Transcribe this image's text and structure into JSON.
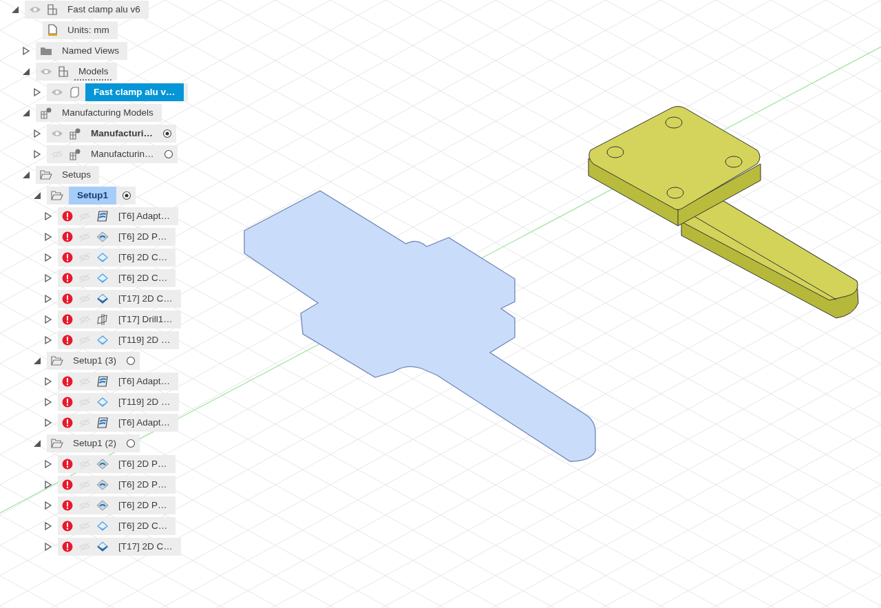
{
  "browser_tree": {
    "items": [
      {
        "label": "Fast clamp alu v6",
        "expanded": true,
        "visible": true,
        "kind": "component",
        "selected": false,
        "children": [
          {
            "label": "Units: mm",
            "kind": "document",
            "selected": false
          },
          {
            "label": "Named Views",
            "expanded": false,
            "kind": "folder",
            "selected": false
          },
          {
            "label": "Models",
            "expanded": true,
            "visible": true,
            "kind": "model-group",
            "selected": false,
            "children": [
              {
                "label": "Fast clamp alu v…",
                "expanded": false,
                "visible": true,
                "kind": "body",
                "selected": true
              }
            ]
          },
          {
            "label": "Manufacturing Models",
            "expanded": true,
            "kind": "mfg",
            "selected": false,
            "children": [
              {
                "label": "Manufacturi…",
                "expanded": false,
                "visible": true,
                "kind": "mfg",
                "active": true,
                "selected": false
              },
              {
                "label": "Manufacturin…",
                "expanded": false,
                "visible": false,
                "kind": "mfg",
                "active": false,
                "selected": false
              }
            ]
          },
          {
            "label": "Setups",
            "expanded": true,
            "kind": "setup",
            "selected": false,
            "children": [
              {
                "label": "Setup1",
                "expanded": true,
                "kind": "setup",
                "active": true,
                "selected": false,
                "highlighted": true,
                "children": [
                  {
                    "label": "[T6] Adapt…",
                    "expanded": false,
                    "warning": true,
                    "visible": false,
                    "kind": "adaptive",
                    "selected": false
                  },
                  {
                    "label": "[T6] 2D P…",
                    "expanded": false,
                    "warning": true,
                    "visible": false,
                    "kind": "pocket",
                    "selected": false
                  },
                  {
                    "label": "[T6] 2D C…",
                    "expanded": false,
                    "warning": true,
                    "visible": false,
                    "kind": "contour",
                    "selected": false
                  },
                  {
                    "label": "[T6] 2D C…",
                    "expanded": false,
                    "warning": true,
                    "visible": false,
                    "kind": "contour",
                    "selected": false
                  },
                  {
                    "label": "[T17] 2D C…",
                    "expanded": false,
                    "warning": true,
                    "visible": false,
                    "kind": "contour-dark",
                    "selected": false
                  },
                  {
                    "label": "[T17] Drill1…",
                    "expanded": false,
                    "warning": true,
                    "visible": false,
                    "kind": "drill",
                    "selected": false
                  },
                  {
                    "label": "[T119] 2D …",
                    "expanded": false,
                    "warning": true,
                    "visible": false,
                    "kind": "contour",
                    "selected": false
                  }
                ]
              },
              {
                "label": "Setup1 (3)",
                "expanded": true,
                "kind": "setup",
                "active": false,
                "selected": false,
                "children": [
                  {
                    "label": "[T6] Adapt…",
                    "expanded": false,
                    "warning": true,
                    "visible": false,
                    "kind": "adaptive",
                    "selected": false
                  },
                  {
                    "label": "[T119] 2D …",
                    "expanded": false,
                    "warning": true,
                    "visible": false,
                    "kind": "contour",
                    "selected": false
                  },
                  {
                    "label": "[T6] Adapt…",
                    "expanded": false,
                    "warning": true,
                    "visible": false,
                    "kind": "adaptive",
                    "selected": false
                  }
                ]
              },
              {
                "label": "Setup1 (2)",
                "expanded": true,
                "kind": "setup",
                "active": false,
                "selected": false,
                "children": [
                  {
                    "label": "[T6] 2D P…",
                    "expanded": false,
                    "warning": true,
                    "visible": false,
                    "kind": "pocket",
                    "selected": false
                  },
                  {
                    "label": "[T6] 2D P…",
                    "expanded": false,
                    "warning": true,
                    "visible": false,
                    "kind": "pocket",
                    "selected": false
                  },
                  {
                    "label": "[T6] 2D P…",
                    "expanded": false,
                    "warning": true,
                    "visible": false,
                    "kind": "pocket",
                    "selected": false
                  },
                  {
                    "label": "[T6] 2D C…",
                    "expanded": false,
                    "warning": true,
                    "visible": false,
                    "kind": "contour",
                    "selected": false
                  },
                  {
                    "label": "[T17] 2D C…",
                    "expanded": false,
                    "warning": true,
                    "visible": false,
                    "kind": "contour-dark",
                    "selected": false
                  }
                ]
              }
            ]
          }
        ]
      }
    ]
  }
}
